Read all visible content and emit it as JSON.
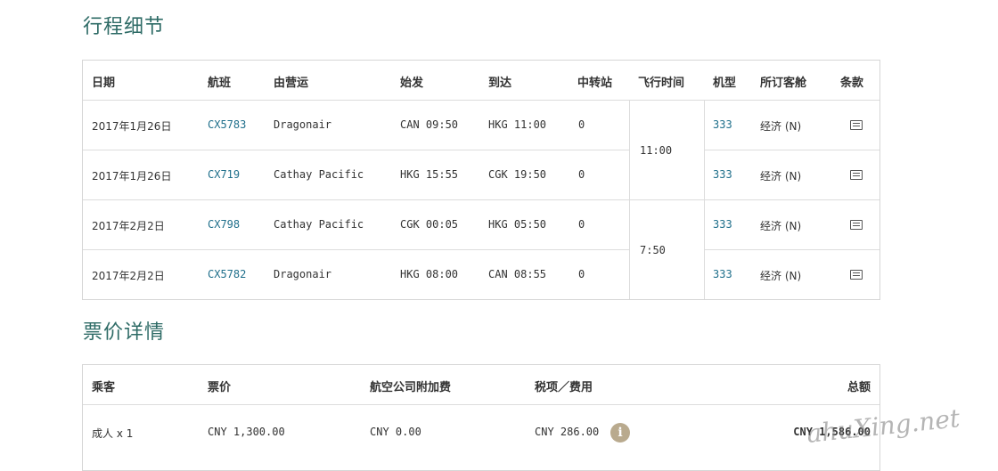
{
  "sections": {
    "itinerary_title": "行程细节",
    "fare_title": "票价详情"
  },
  "itinerary": {
    "headers": [
      "日期",
      "航班",
      "由营运",
      "始发",
      "到达",
      "中转站",
      "飞行时间",
      "机型",
      "所订客舱",
      "条款"
    ],
    "rows": [
      {
        "date": "2017年1月26日",
        "flight": "CX5783",
        "operator": "Dragonair",
        "depart": "CAN 09:50",
        "arrive": "HKG 11:00",
        "stops": "0",
        "aircraft": "333",
        "cabin": "经济 (N)"
      },
      {
        "date": "2017年1月26日",
        "flight": "CX719",
        "operator": "Cathay Pacific",
        "depart": "HKG 15:55",
        "arrive": "CGK 19:50",
        "stops": "0",
        "aircraft": "333",
        "cabin": "经济 (N)"
      },
      {
        "date": "2017年2月2日",
        "flight": "CX798",
        "operator": "Cathay Pacific",
        "depart": "CGK 00:05",
        "arrive": "HKG 05:50",
        "stops": "0",
        "aircraft": "333",
        "cabin": "经济 (N)"
      },
      {
        "date": "2017年2月2日",
        "flight": "CX5782",
        "operator": "Dragonair",
        "depart": "HKG 08:00",
        "arrive": "CAN 08:55",
        "stops": "0",
        "aircraft": "333",
        "cabin": "经济 (N)"
      }
    ],
    "flight_times": [
      "11:00",
      "7:50"
    ]
  },
  "fare": {
    "headers": [
      "乘客",
      "票价",
      "航空公司附加费",
      "税项／费用",
      "总额"
    ],
    "row": {
      "passenger": "成人 x 1",
      "fare": "CNY 1,300.00",
      "surcharge": "CNY 0.00",
      "taxes": "CNY 286.00",
      "total": "CNY 1,586.00"
    },
    "info_icon_glyph": "i"
  },
  "watermark": "ahuXing.net",
  "icons": {
    "terms": "document-icon",
    "info": "info-icon"
  }
}
